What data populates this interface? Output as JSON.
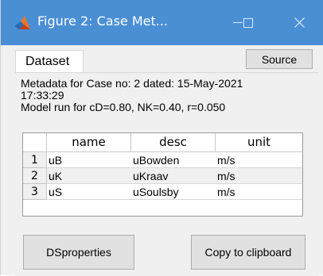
{
  "window": {
    "title": "Figure 2: Case Met...",
    "min_glyph": "—",
    "max_glyph": "☐",
    "close_glyph": "✕",
    "titlebar_color": "#4a8fd4",
    "app_icon": "matlab-logo-icon"
  },
  "tabs": [
    {
      "label": "Dataset"
    }
  ],
  "toolbar": {
    "source_label": "Source"
  },
  "metadata": {
    "line1": "Metadata for Case no: 2 dated: 15-May-2021",
    "line2": "17:33:29",
    "line3": "Model run for cD=0.80, NK=0.40, r=0.050"
  },
  "table": {
    "columns": [
      "name",
      "desc",
      "unit"
    ],
    "rows": [
      {
        "index": "1",
        "name": "uB",
        "desc": "uBowden",
        "unit": "m/s"
      },
      {
        "index": "2",
        "name": "uK",
        "desc": "uKraav",
        "unit": "m/s"
      },
      {
        "index": "3",
        "name": "uS",
        "desc": "uSoulsby",
        "unit": "m/s"
      }
    ]
  },
  "buttons": {
    "dsproperties_label": "DSproperties",
    "copy_label": "Copy to clipboard"
  }
}
